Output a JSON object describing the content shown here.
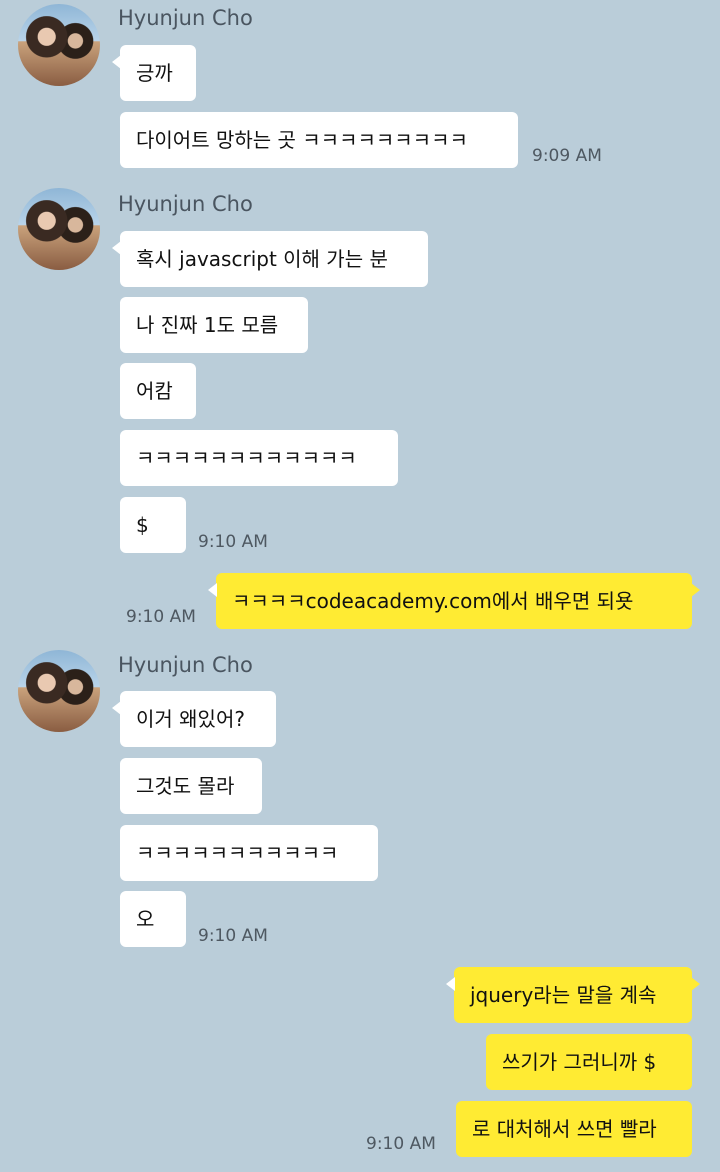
{
  "groups": [
    {
      "sender": "Hyunjun Cho",
      "messages": [
        "긍까",
        "다이어트 망하는 곳 ㅋㅋㅋㅋㅋㅋㅋㅋㅋ"
      ],
      "time": "9:09 AM"
    },
    {
      "sender": "Hyunjun Cho",
      "messages": [
        "혹시 javascript 이해 가는 분",
        "나 진짜 1도 모름",
        "어캄",
        "ㅋㅋㅋㅋㅋㅋㅋㅋㅋㅋㅋㅋ",
        "$"
      ],
      "time": "9:10 AM"
    },
    {
      "sender": "me",
      "messages": [
        "ㅋㅋㅋㅋcodeacademy.com에서 배우면 되욧"
      ],
      "time": "9:10 AM"
    },
    {
      "sender": "Hyunjun Cho",
      "messages": [
        "이거 왜있어?",
        "그것도 몰라",
        "ㅋㅋㅋㅋㅋㅋㅋㅋㅋㅋㅋ",
        "오"
      ],
      "time": "9:10 AM"
    },
    {
      "sender": "me",
      "messages": [
        "jquery라는 말을 계속",
        "쓰기가 그러니까 $",
        "로 대처해서 쓰면 빨라"
      ],
      "time": "9:10 AM"
    }
  ]
}
